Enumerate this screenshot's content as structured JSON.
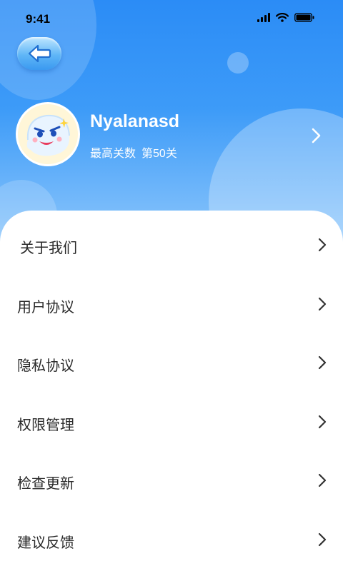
{
  "status_bar": {
    "time": "9:41",
    "icons": [
      "signal-icon",
      "wifi-icon",
      "battery-icon"
    ]
  },
  "header": {
    "back_icon": "arrow-left-icon"
  },
  "profile": {
    "username": "Nyalanasd",
    "level_label": "最高关数",
    "level_value": "第50关",
    "avatar_icon": "ghost-mascot-avatar"
  },
  "menu": {
    "items": [
      {
        "label": "关于我们"
      },
      {
        "label": "用户协议"
      },
      {
        "label": "隐私协议"
      },
      {
        "label": "权限管理"
      },
      {
        "label": "检查更新"
      },
      {
        "label": "建议反馈"
      }
    ]
  },
  "colors": {
    "header_top": "#2b8cf6",
    "header_bottom": "#8cc6fb",
    "text": "#2a2a2a",
    "arrow": "#333333"
  }
}
